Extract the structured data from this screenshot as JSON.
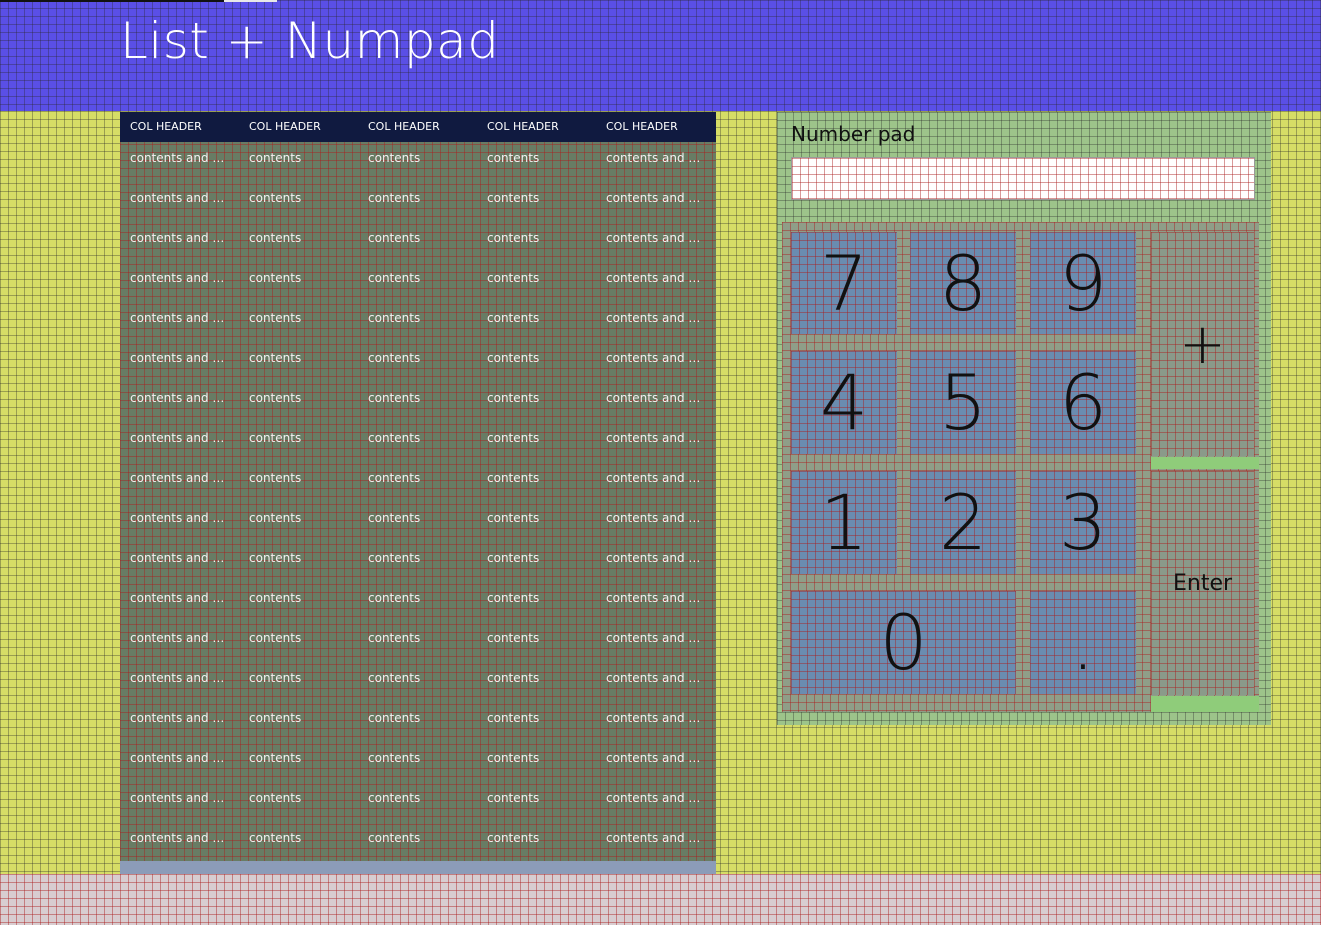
{
  "app": {
    "title": "List + Numpad"
  },
  "colors": {
    "titlebar": "#5a4fe6",
    "content_bg": "#d6dd66",
    "grid_bg": "#687c64",
    "grid_header_bg": "#101a40",
    "numpad_bg": "#9dc48a",
    "key_bg": "#6a8cb0"
  },
  "table": {
    "headers": [
      "COL HEADER",
      "COL HEADER",
      "COL HEADER",
      "COL HEADER",
      "COL HEADER"
    ],
    "rows": [
      [
        "contents and contents",
        "contents",
        "contents",
        "contents",
        "contents and contents"
      ],
      [
        "contents and contents",
        "contents",
        "contents",
        "contents",
        "contents and contents"
      ],
      [
        "contents and contents",
        "contents",
        "contents",
        "contents",
        "contents and contents"
      ],
      [
        "contents and contents",
        "contents",
        "contents",
        "contents",
        "contents and contents"
      ],
      [
        "contents and contents",
        "contents",
        "contents",
        "contents",
        "contents and contents"
      ],
      [
        "contents and contents",
        "contents",
        "contents",
        "contents",
        "contents and contents"
      ],
      [
        "contents and contents",
        "contents",
        "contents",
        "contents",
        "contents and contents"
      ],
      [
        "contents and contents",
        "contents",
        "contents",
        "contents",
        "contents and contents"
      ],
      [
        "contents and contents",
        "contents",
        "contents",
        "contents",
        "contents and contents"
      ],
      [
        "contents and contents",
        "contents",
        "contents",
        "contents",
        "contents and contents"
      ],
      [
        "contents and contents",
        "contents",
        "contents",
        "contents",
        "contents and contents"
      ],
      [
        "contents and contents",
        "contents",
        "contents",
        "contents",
        "contents and contents"
      ],
      [
        "contents and contents",
        "contents",
        "contents",
        "contents",
        "contents and contents"
      ],
      [
        "contents and contents",
        "contents",
        "contents",
        "contents",
        "contents and contents"
      ],
      [
        "contents and contents",
        "contents",
        "contents",
        "contents",
        "contents and contents"
      ],
      [
        "contents and contents",
        "contents",
        "contents",
        "contents",
        "contents and contents"
      ],
      [
        "contents and contents",
        "contents",
        "contents",
        "contents",
        "contents and contents"
      ],
      [
        "contents and contents",
        "contents",
        "contents",
        "contents",
        "contents and contents"
      ]
    ]
  },
  "numpad": {
    "label": "Number pad",
    "input_value": "",
    "keys": {
      "k7": "7",
      "k8": "8",
      "k9": "9",
      "k4": "4",
      "k5": "5",
      "k6": "6",
      "k1": "1",
      "k2": "2",
      "k3": "3",
      "k0": "0",
      "kdot": "."
    },
    "plus": "+",
    "enter": "Enter"
  }
}
